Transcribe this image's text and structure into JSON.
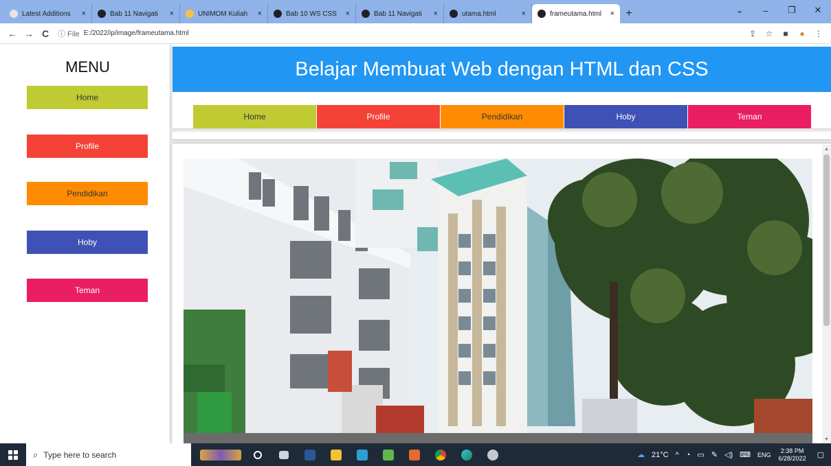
{
  "browser": {
    "tabs": [
      {
        "label": "Latest Additions",
        "favicon_color": "#e4e4e4",
        "active": false
      },
      {
        "label": "Bab 11 Navigati",
        "favicon_color": "#202124",
        "active": false
      },
      {
        "label": "UNIMOM Kuliah",
        "favicon_color": "#f6c343",
        "active": false
      },
      {
        "label": "Bab 10 WS CSS",
        "favicon_color": "#202124",
        "active": false
      },
      {
        "label": "Bab 11 Navigati",
        "favicon_color": "#202124",
        "active": false
      },
      {
        "label": "utama.html",
        "favicon_color": "#202124",
        "active": false
      },
      {
        "label": "frameutama.html",
        "favicon_color": "#202124",
        "active": true
      }
    ],
    "new_tab": "+",
    "controls": {
      "dropdown": "⌄",
      "minimize": "–",
      "restore": "❐",
      "close": "✕"
    },
    "nav": {
      "back": "←",
      "forward": "→",
      "reload": "C"
    },
    "address": {
      "info": "ⓘ File",
      "url": "E:/2022/ip/image/frameutama.html"
    },
    "toolbar": {
      "share": "⇪",
      "star": "☆",
      "sidepanel": "■",
      "profile": "●",
      "menu": "⋮"
    }
  },
  "page": {
    "menu_title": "MENU",
    "sidebar": [
      {
        "label": "Home",
        "color": "#c0ca33",
        "text_color": "#333333"
      },
      {
        "label": "Profile",
        "color": "#f44336",
        "text_color": "#ffffff"
      },
      {
        "label": "Pendidikan",
        "color": "#ff8c00",
        "text_color": "#333333"
      },
      {
        "label": "Hoby",
        "color": "#3f51b5",
        "text_color": "#ffffff"
      },
      {
        "label": "Teman",
        "color": "#e91e63",
        "text_color": "#ffffff"
      }
    ],
    "header_title": "Belajar Membuat Web dengan HTML dan CSS",
    "header_color": "#2196f3",
    "topnav": [
      {
        "label": "Home",
        "color": "#c0ca33",
        "text_color": "#333333"
      },
      {
        "label": "Profile",
        "color": "#f44336",
        "text_color": "#ffffff"
      },
      {
        "label": "Pendidikan",
        "color": "#ff8c00",
        "text_color": "#333333"
      },
      {
        "label": "Hoby",
        "color": "#3f51b5",
        "text_color": "#ffffff"
      },
      {
        "label": "Teman",
        "color": "#e91e63",
        "text_color": "#ffffff"
      }
    ]
  },
  "taskbar": {
    "search_placeholder": "Type here to search",
    "weather": "21°C",
    "language": "ENG",
    "time": "2:38 PM",
    "date": "6/28/2022"
  }
}
